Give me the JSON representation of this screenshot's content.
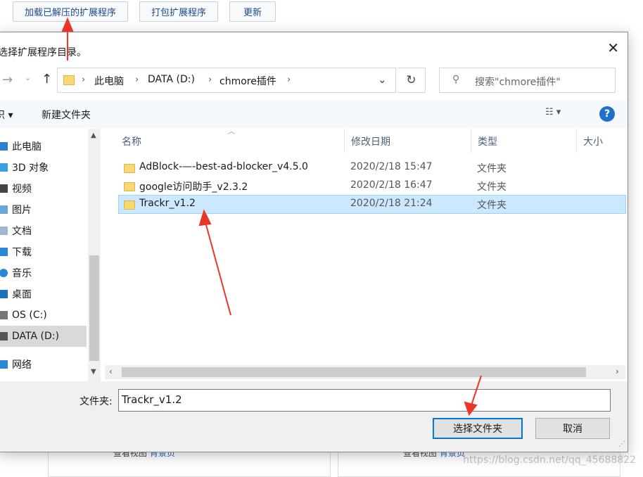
{
  "page": {
    "buttons": [
      "加载已解压的扩展程序",
      "打包扩展程序",
      "更新"
    ],
    "card_links": [
      {
        "prefix": "查看视图",
        "link": "背景页"
      },
      {
        "prefix": "查看视图",
        "link": "背景页"
      }
    ],
    "watermark": "https://blog.csdn.net/qq_45688822"
  },
  "dialog": {
    "title": "选择扩展程序目录。",
    "close": "✕",
    "path": [
      "此电脑",
      "DATA (D:)",
      "chmore插件"
    ],
    "search_placeholder": "搜索\"chmore插件\"",
    "organize": "组织",
    "new_folder": "新建文件夹",
    "nav": [
      "此电脑",
      "3D 对象",
      "视频",
      "图片",
      "文档",
      "下载",
      "音乐",
      "桌面",
      "OS (C:)",
      "DATA (D:)",
      "网络"
    ],
    "columns": [
      "名称",
      "修改日期",
      "类型",
      "大小"
    ],
    "files": [
      {
        "name": "AdBlock-—-best-ad-blocker_v4.5.0",
        "date": "2020/2/18 15:47",
        "type": "文件夹"
      },
      {
        "name": "google访问助手_v2.3.2",
        "date": "2020/2/18 16:47",
        "type": "文件夹"
      },
      {
        "name": "Trackr_v1.2",
        "date": "2020/2/18 21:24",
        "type": "文件夹"
      }
    ],
    "folder_label": "文件夹:",
    "folder_value": "Trackr_v1.2",
    "select_button": "选择文件夹",
    "cancel_button": "取消"
  },
  "colors": {
    "selection": "#cce8ff",
    "link": "#1a5fc1",
    "annotation": "#e8372a"
  }
}
